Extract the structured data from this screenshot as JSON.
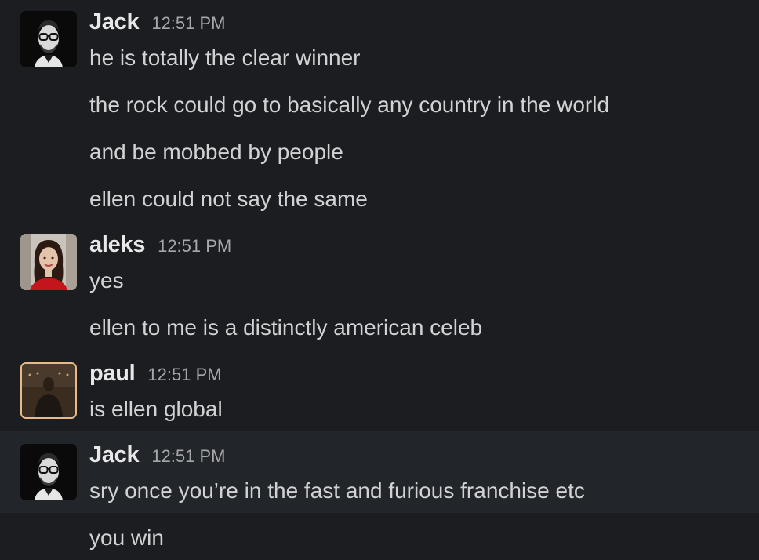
{
  "messages": [
    {
      "author": "Jack",
      "time": "12:51 PM",
      "avatar_icon": "man-with-glasses-avatar",
      "lines": [
        "he is totally the clear winner",
        "the rock could go to basically any country in the world",
        "and be mobbed by people",
        "ellen could not say the same"
      ]
    },
    {
      "author": "aleks",
      "time": "12:51 PM",
      "avatar_icon": "woman-portrait-avatar",
      "lines": [
        "yes",
        "ellen to me is a distinctly american celeb"
      ]
    },
    {
      "author": "paul",
      "time": "12:51 PM",
      "avatar_icon": "man-in-dark-room-avatar",
      "lines": [
        "is ellen global"
      ]
    },
    {
      "author": "Jack",
      "time": "12:51 PM",
      "avatar_icon": "man-with-glasses-avatar",
      "lines": [
        "sry once you’re in the fast and furious franchise etc",
        "you win"
      ]
    }
  ],
  "colors": {
    "background": "#1b1d21",
    "hover_background": "#222529",
    "text": "#d1d2d3",
    "author": "#e8e8e8",
    "timestamp": "#a6a7a9"
  }
}
